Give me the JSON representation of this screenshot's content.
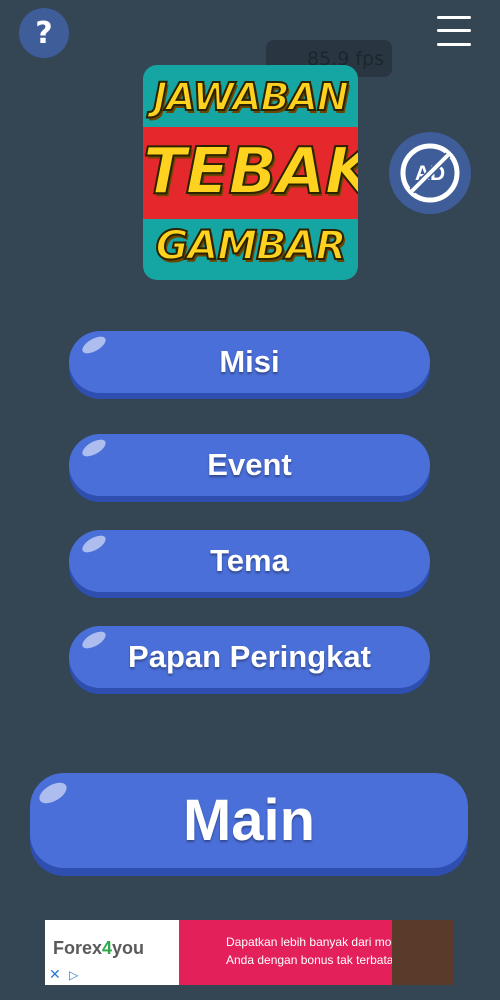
{
  "header": {
    "help_label": "?",
    "help_icon": "question-icon",
    "menu_icon": "hamburger-menu-icon",
    "fps_text": "85,9 fps"
  },
  "logo": {
    "line1": "JAWABAN",
    "line2": "TEBAK",
    "line3": "GAMBAR",
    "colors": {
      "teal": "#15a5a2",
      "red": "#e4282c",
      "yellow": "#ffd21f"
    }
  },
  "no_ads": {
    "icon": "no-ads-icon",
    "label": "AD"
  },
  "menu": {
    "items": [
      {
        "label": "Misi"
      },
      {
        "label": "Event"
      },
      {
        "label": "Tema"
      },
      {
        "label": "Papan Peringkat"
      }
    ]
  },
  "main_button": {
    "label": "Main"
  },
  "ad": {
    "brand_part1": "Forex",
    "brand_part2": "4",
    "brand_part3": "you",
    "text_line1": "Dapatkan lebih banyak dari modal",
    "text_line2": "Anda dengan bonus tak terbatas.",
    "close_icon": "close-icon",
    "adchoices_icon": "adchoices-icon"
  },
  "colors": {
    "background": "#344554",
    "button": "#4a6fd9",
    "button_shadow": "#2e4fb0",
    "circle_button": "#3e5d99"
  }
}
